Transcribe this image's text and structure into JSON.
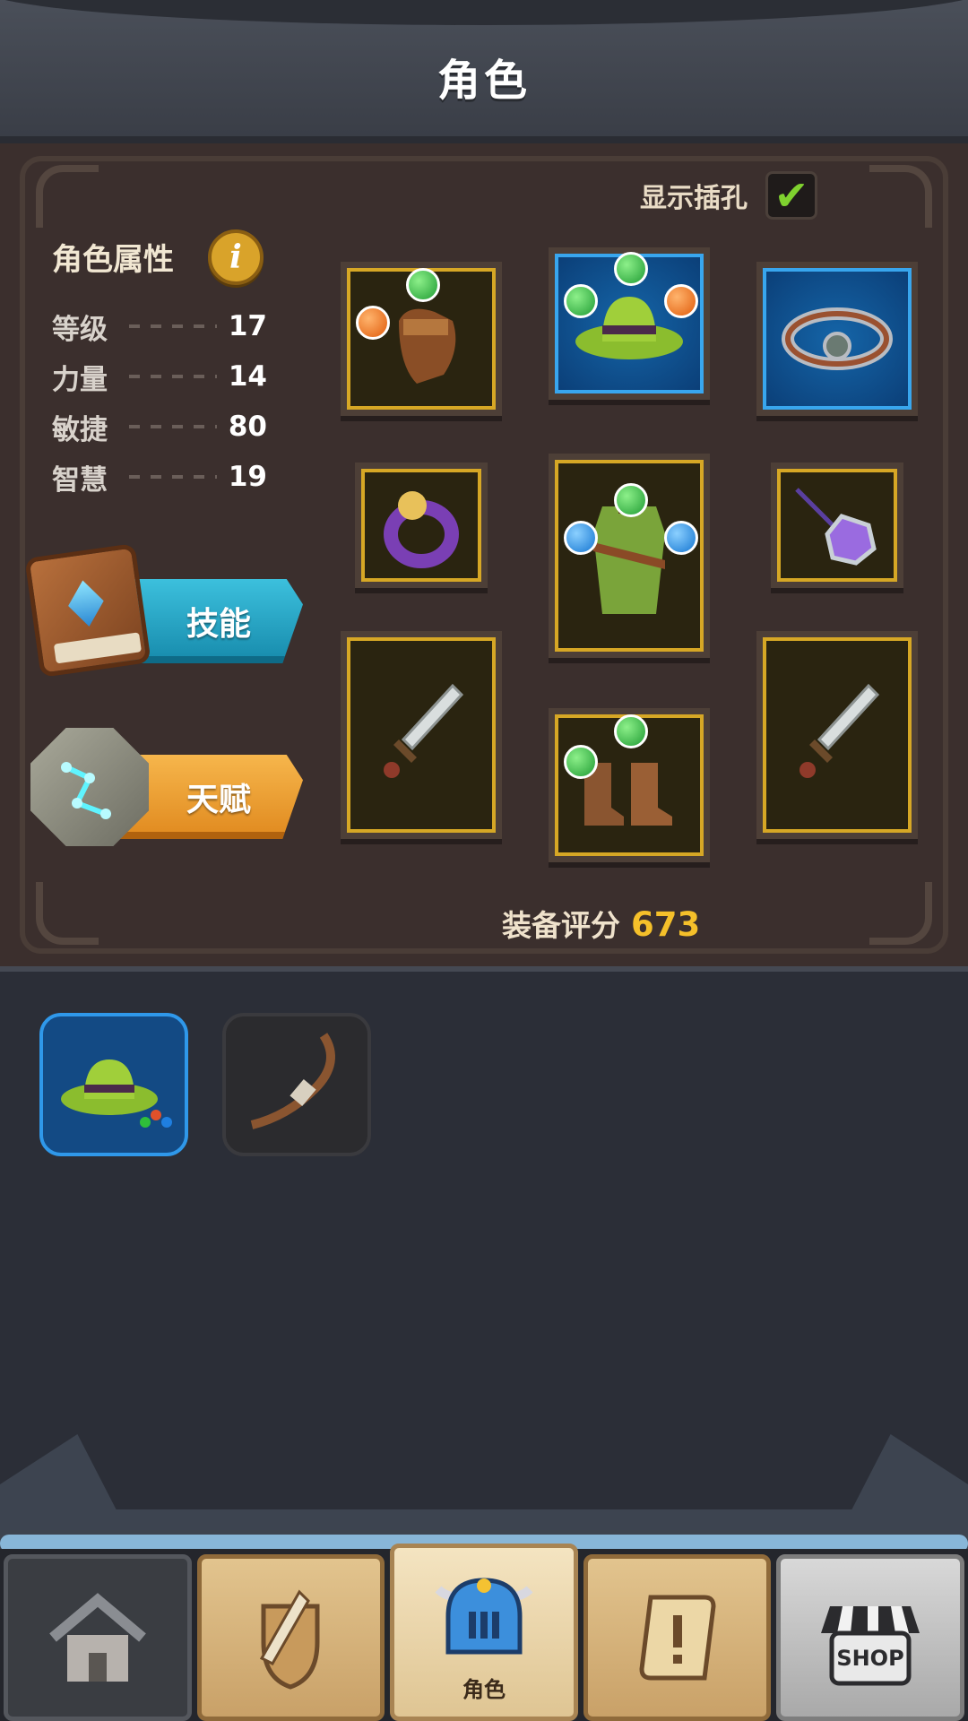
{
  "header": {
    "title": "角色"
  },
  "panel": {
    "show_sockets_label": "显示插孔",
    "show_sockets_checked": true,
    "attributes_title": "角色属性",
    "stats": [
      {
        "label": "等级",
        "value": "17"
      },
      {
        "label": "力量",
        "value": "14"
      },
      {
        "label": "敏捷",
        "value": "80"
      },
      {
        "label": "智慧",
        "value": "19"
      }
    ],
    "skill_button_label": "技能",
    "talent_button_label": "天赋",
    "score_label": "装备评分",
    "score_value": "673",
    "slots": [
      {
        "item": "gloves-icon",
        "frame": "gold",
        "gems": [
          "orange",
          "green"
        ]
      },
      {
        "item": "hat-icon",
        "frame": "blue",
        "gems": [
          "green",
          "green",
          "orange"
        ]
      },
      {
        "item": "bracer-icon",
        "frame": "blue",
        "gems": []
      },
      {
        "item": "ring-icon",
        "frame": "gold",
        "gems": []
      },
      {
        "item": "armor-icon",
        "frame": "gold",
        "gems": [
          "blue",
          "green",
          "blue"
        ]
      },
      {
        "item": "amulet-icon",
        "frame": "gold",
        "gems": []
      },
      {
        "item": "sword-icon",
        "frame": "gold",
        "gems": []
      },
      {
        "item": "boots-icon",
        "frame": "gold",
        "gems": [
          "green",
          "green"
        ]
      },
      {
        "item": "sword-icon",
        "frame": "gold",
        "gems": []
      }
    ]
  },
  "inventory": {
    "items": [
      {
        "item": "hat-icon",
        "rarity": "blue"
      },
      {
        "item": "bow-icon",
        "rarity": "common"
      }
    ]
  },
  "nav": {
    "items": [
      {
        "icon": "home-icon"
      },
      {
        "icon": "sword-shield-icon"
      },
      {
        "icon": "helmet-icon",
        "label": "角色",
        "active": true
      },
      {
        "icon": "quest-scroll-icon"
      },
      {
        "icon": "shop-icon",
        "text": "SHOP"
      }
    ]
  },
  "colors": {
    "gold": "#d6a725",
    "blue": "#38a6ee",
    "score": "#f5c02a",
    "check": "#7fd12f"
  }
}
